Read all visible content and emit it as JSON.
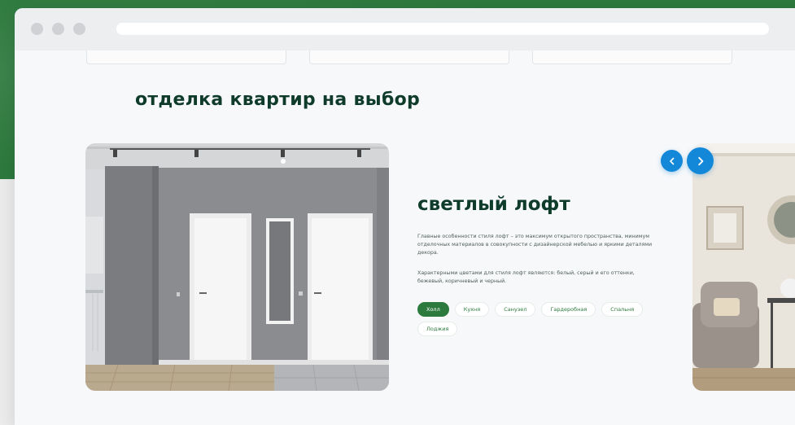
{
  "section": {
    "heading": "отделка квартир на выбор"
  },
  "slide": {
    "title": "светлый лофт",
    "paragraphs": [
      "Главные особенности стиля лофт – это максимум открытого пространства, минимум отделочных материалов в совокупности с дизайнерской мебелью и яркими деталями декора.",
      "Характерными цветами для стиля лофт являются: белый, серый и его оттенки, бежевый, коричневый и черный."
    ],
    "tags": [
      {
        "label": "Холл",
        "active": true
      },
      {
        "label": "Кухня",
        "active": false
      },
      {
        "label": "Санузел",
        "active": false
      },
      {
        "label": "Гардеробная",
        "active": false
      },
      {
        "label": "Спальня",
        "active": false
      },
      {
        "label": "Лоджия",
        "active": false
      }
    ]
  },
  "carousel": {
    "prev_icon": "chevron-left-icon",
    "next_icon": "chevron-right-icon"
  },
  "colors": {
    "brand_green": "#2d7a3e",
    "heading_dark": "#0f3b2b",
    "arrow_blue": "#1488d8"
  }
}
